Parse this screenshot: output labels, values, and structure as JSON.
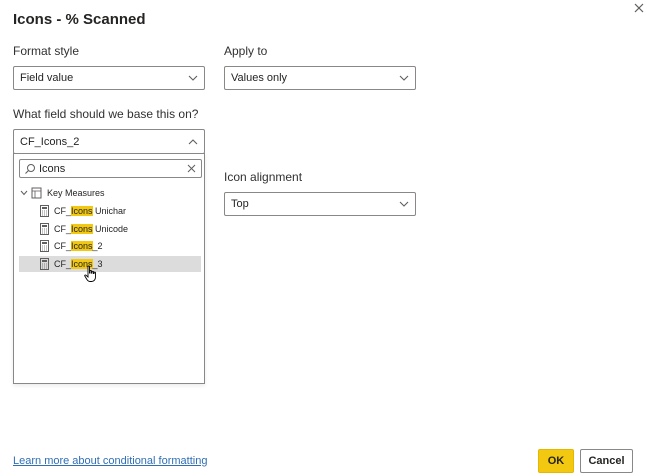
{
  "dialog": {
    "title": "Icons - % Scanned",
    "close_icon": "close-icon"
  },
  "format_style": {
    "label": "Format style",
    "value": "Field value"
  },
  "apply_to": {
    "label": "Apply to",
    "value": "Values only"
  },
  "base_field": {
    "label": "What field should we base this on?",
    "value": "CF_Icons_2",
    "search": {
      "value": "Icons"
    },
    "tree": {
      "group": "Key Measures",
      "items": [
        {
          "prefix": "CF_",
          "match": "Icons",
          "suffix": " Unichar"
        },
        {
          "prefix": "CF_",
          "match": "Icons",
          "suffix": " Unicode"
        },
        {
          "prefix": "CF_",
          "match": "Icons",
          "suffix": "_2"
        },
        {
          "prefix": "CF_",
          "match": "Icons",
          "suffix": "_3"
        }
      ]
    }
  },
  "icon_alignment": {
    "label": "Icon alignment",
    "value": "Top"
  },
  "footer": {
    "learn_more": "Learn more about conditional formatting",
    "ok_label": "OK",
    "cancel_label": "Cancel"
  },
  "colors": {
    "accent": "#f2c811",
    "link": "#2f6fb5",
    "selection": "#dcdcdc"
  }
}
